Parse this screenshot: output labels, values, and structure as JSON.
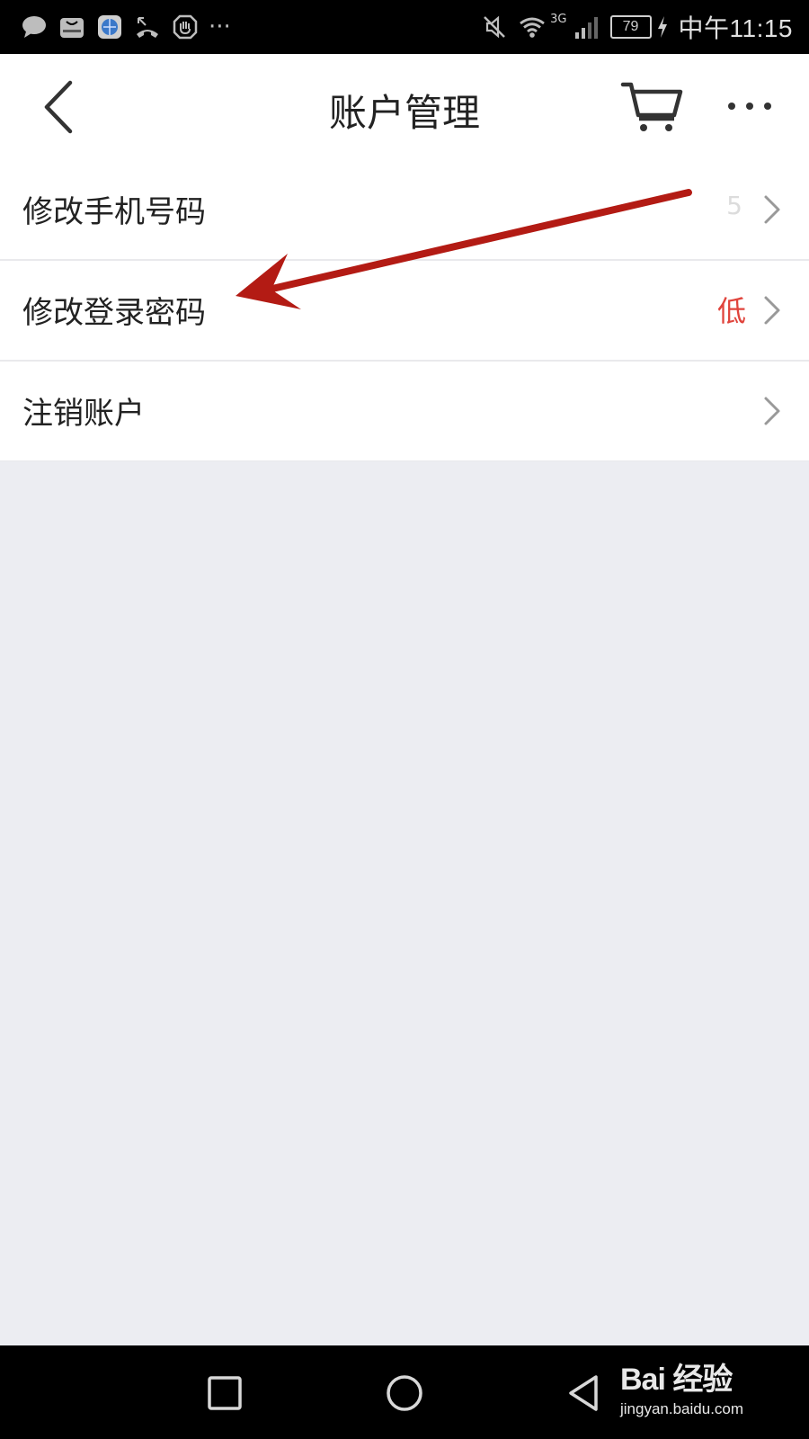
{
  "status_bar": {
    "network_label": "3G",
    "battery": "79",
    "time": "中午11:15",
    "more": "···"
  },
  "nav": {
    "title": "账户管理"
  },
  "menu": {
    "items": [
      {
        "label": "修改手机号码",
        "value": "5"
      },
      {
        "label": "修改登录密码",
        "value": "低"
      },
      {
        "label": "注销账户",
        "value": ""
      }
    ]
  },
  "watermark": {
    "logo": "Bai 经验",
    "url": "jingyan.baidu.com"
  },
  "colors": {
    "accent_red": "#e0443c",
    "annotation_arrow": "#b31b14",
    "page_background": "#ecedf2"
  }
}
